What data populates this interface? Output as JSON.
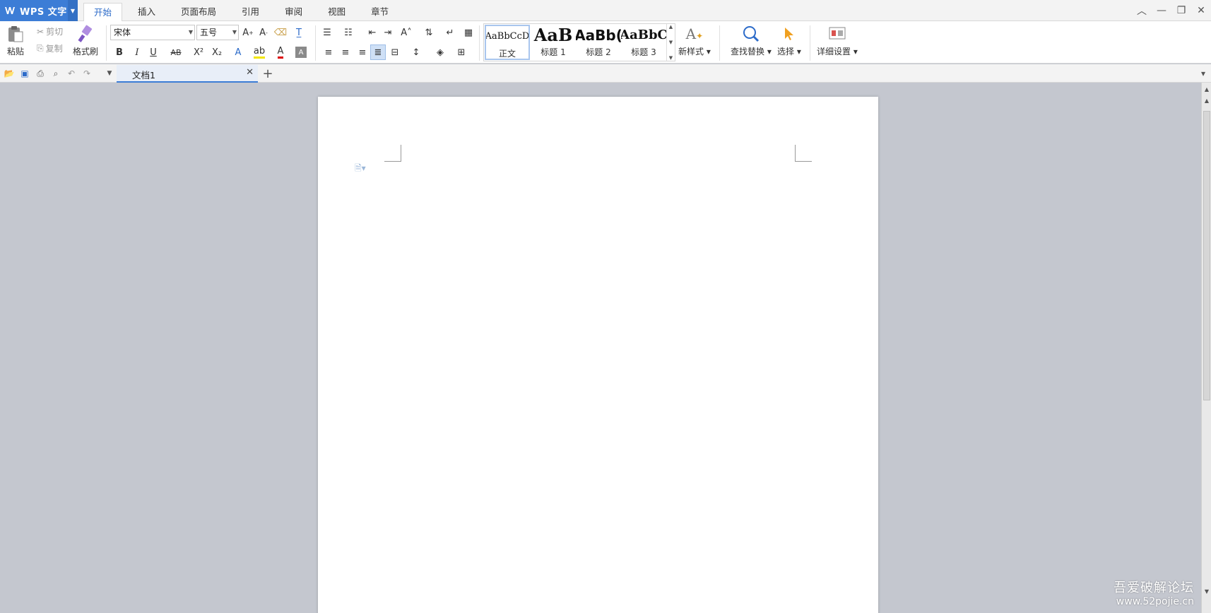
{
  "app": {
    "name": "WPS 文字"
  },
  "tabs": [
    {
      "label": "开始",
      "active": true
    },
    {
      "label": "插入"
    },
    {
      "label": "页面布局"
    },
    {
      "label": "引用"
    },
    {
      "label": "审阅"
    },
    {
      "label": "视图"
    },
    {
      "label": "章节"
    }
  ],
  "ribbon": {
    "paste": "粘贴",
    "cut": "剪切",
    "copy": "复制",
    "format_painter": "格式刷",
    "font_name": "宋体",
    "font_size": "五号",
    "styles": [
      {
        "preview": "AaBbCcD",
        "name": "正文"
      },
      {
        "preview": "AaB",
        "name": "标题 1"
      },
      {
        "preview": "AaBb(",
        "name": "标题 2"
      },
      {
        "preview": "AaBbC",
        "name": "标题 3"
      }
    ],
    "new_style": "新样式",
    "find_replace": "查找替换",
    "select": "选择",
    "detail_settings": "详细设置"
  },
  "document_tab": {
    "title": "文档1"
  },
  "watermark": {
    "line1": "吾爱破解论坛",
    "line2": "www.52pojie.cn"
  },
  "colors": {
    "accent": "#3c7dd6",
    "workspace": "#c4c7cf"
  }
}
